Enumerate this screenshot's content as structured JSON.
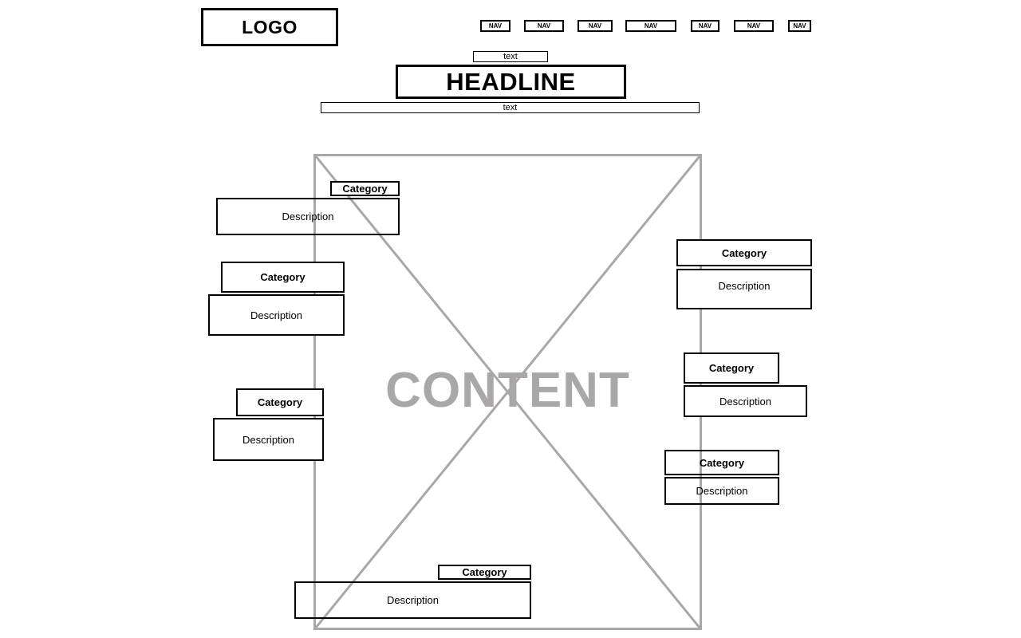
{
  "header": {
    "logo": "LOGO",
    "nav": [
      "NAV",
      "NAV",
      "NAV",
      "NAV",
      "NAV",
      "NAV",
      "NAV"
    ]
  },
  "hero": {
    "eyebrow": "text",
    "headline": "HEADLINE",
    "subtext": "text"
  },
  "content": {
    "label": "CONTENT",
    "placeholder_color": "#aaa7a7"
  },
  "callouts": [
    {
      "category": "Category",
      "description": "Description"
    },
    {
      "category": "Category",
      "description": "Description"
    },
    {
      "category": "Category",
      "description": "Description"
    },
    {
      "category": "Category",
      "description": "Description"
    },
    {
      "category": "Category",
      "description": "Description"
    },
    {
      "category": "Category",
      "description": "Description"
    },
    {
      "category": "Category",
      "description": "Description"
    }
  ]
}
